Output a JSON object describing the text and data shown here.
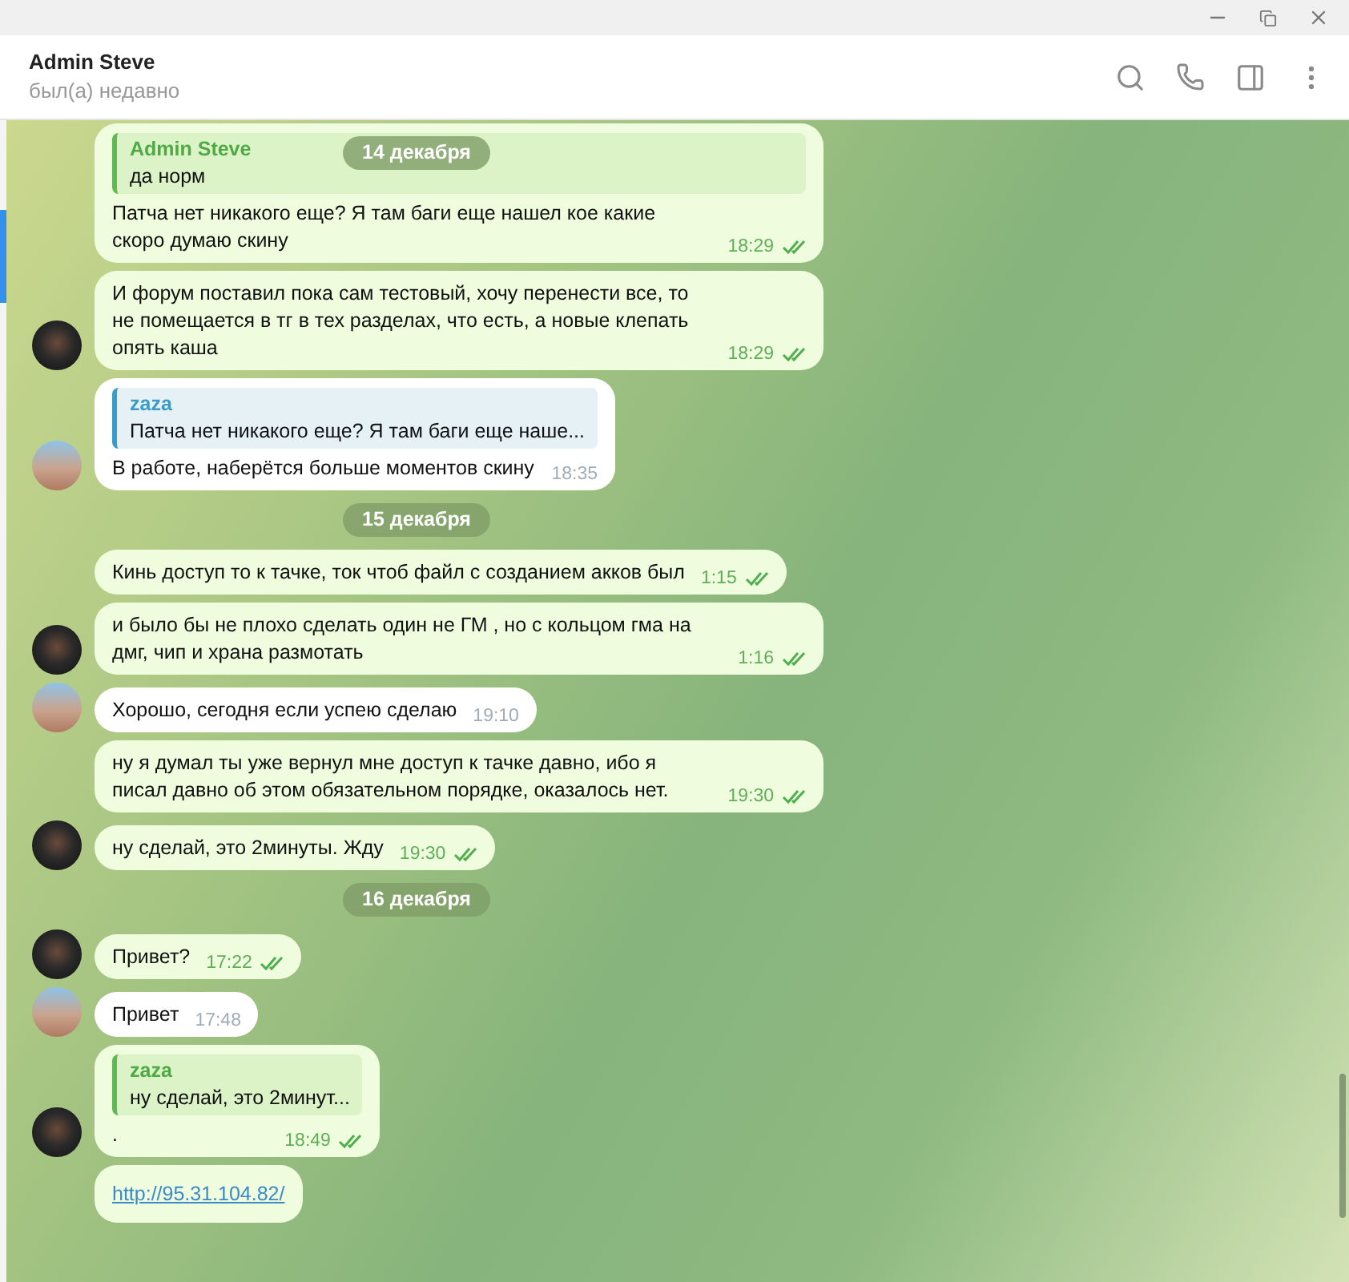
{
  "header": {
    "title": "Admin Steve",
    "status": "был(а) недавно"
  },
  "sticky_date": "14 декабря",
  "messages": [
    {
      "kind": "message",
      "outgoing": true,
      "avatar": false,
      "reply": {
        "name": "Admin Steve",
        "text": "да норм"
      },
      "text": "Патча нет никакого еще? Я там баги еще нашел кое какие скоро думаю скину",
      "time": "18:29",
      "read": true
    },
    {
      "kind": "message",
      "outgoing": true,
      "avatar": true,
      "text": "И форум поставил пока сам тестовый, хочу перенести все, то не помещается в тг в тех разделах, что есть, а новые клепать опять каша",
      "time": "18:29",
      "read": true
    },
    {
      "kind": "message",
      "outgoing": false,
      "avatar": true,
      "reply": {
        "name": "zaza",
        "text": "Патча нет никакого еще? Я там баги еще наше..."
      },
      "text": "В работе, наберётся больше моментов скину",
      "time": "18:35"
    },
    {
      "kind": "date",
      "text": "15 декабря"
    },
    {
      "kind": "message",
      "outgoing": true,
      "avatar": false,
      "text": "Кинь доступ то к тачке, ток чтоб файл с созданием акков был",
      "time": "1:15",
      "read": true
    },
    {
      "kind": "message",
      "outgoing": true,
      "avatar": true,
      "text": "и было бы не плохо сделать один не ГМ , но с кольцом гма на дмг, чип и храна размотать",
      "time": "1:16",
      "read": true
    },
    {
      "kind": "message",
      "outgoing": false,
      "avatar": true,
      "text": "Хорошо, сегодня если успею сделаю",
      "time": "19:10"
    },
    {
      "kind": "message",
      "outgoing": true,
      "avatar": false,
      "text": "ну я думал ты уже вернул мне доступ к тачке давно, ибо я писал давно об этом обязательном порядке, оказалось нет.",
      "time": "19:30",
      "read": true
    },
    {
      "kind": "message",
      "outgoing": true,
      "avatar": true,
      "text": "ну сделай, это 2минуты. Жду",
      "time": "19:30",
      "read": true
    },
    {
      "kind": "date",
      "text": "16 декабря"
    },
    {
      "kind": "message",
      "outgoing": true,
      "avatar": true,
      "text": "Привет?",
      "time": "17:22",
      "read": true
    },
    {
      "kind": "message",
      "outgoing": false,
      "avatar": true,
      "text": "Привет",
      "time": "17:48"
    },
    {
      "kind": "message",
      "outgoing": true,
      "avatar": true,
      "reply": {
        "name": "zaza",
        "text": "ну сделай, это 2минут..."
      },
      "text": ".",
      "time": "18:49",
      "read": true
    },
    {
      "kind": "link",
      "outgoing": true,
      "avatar": false,
      "text": "http://95.31.104.82/"
    }
  ]
}
